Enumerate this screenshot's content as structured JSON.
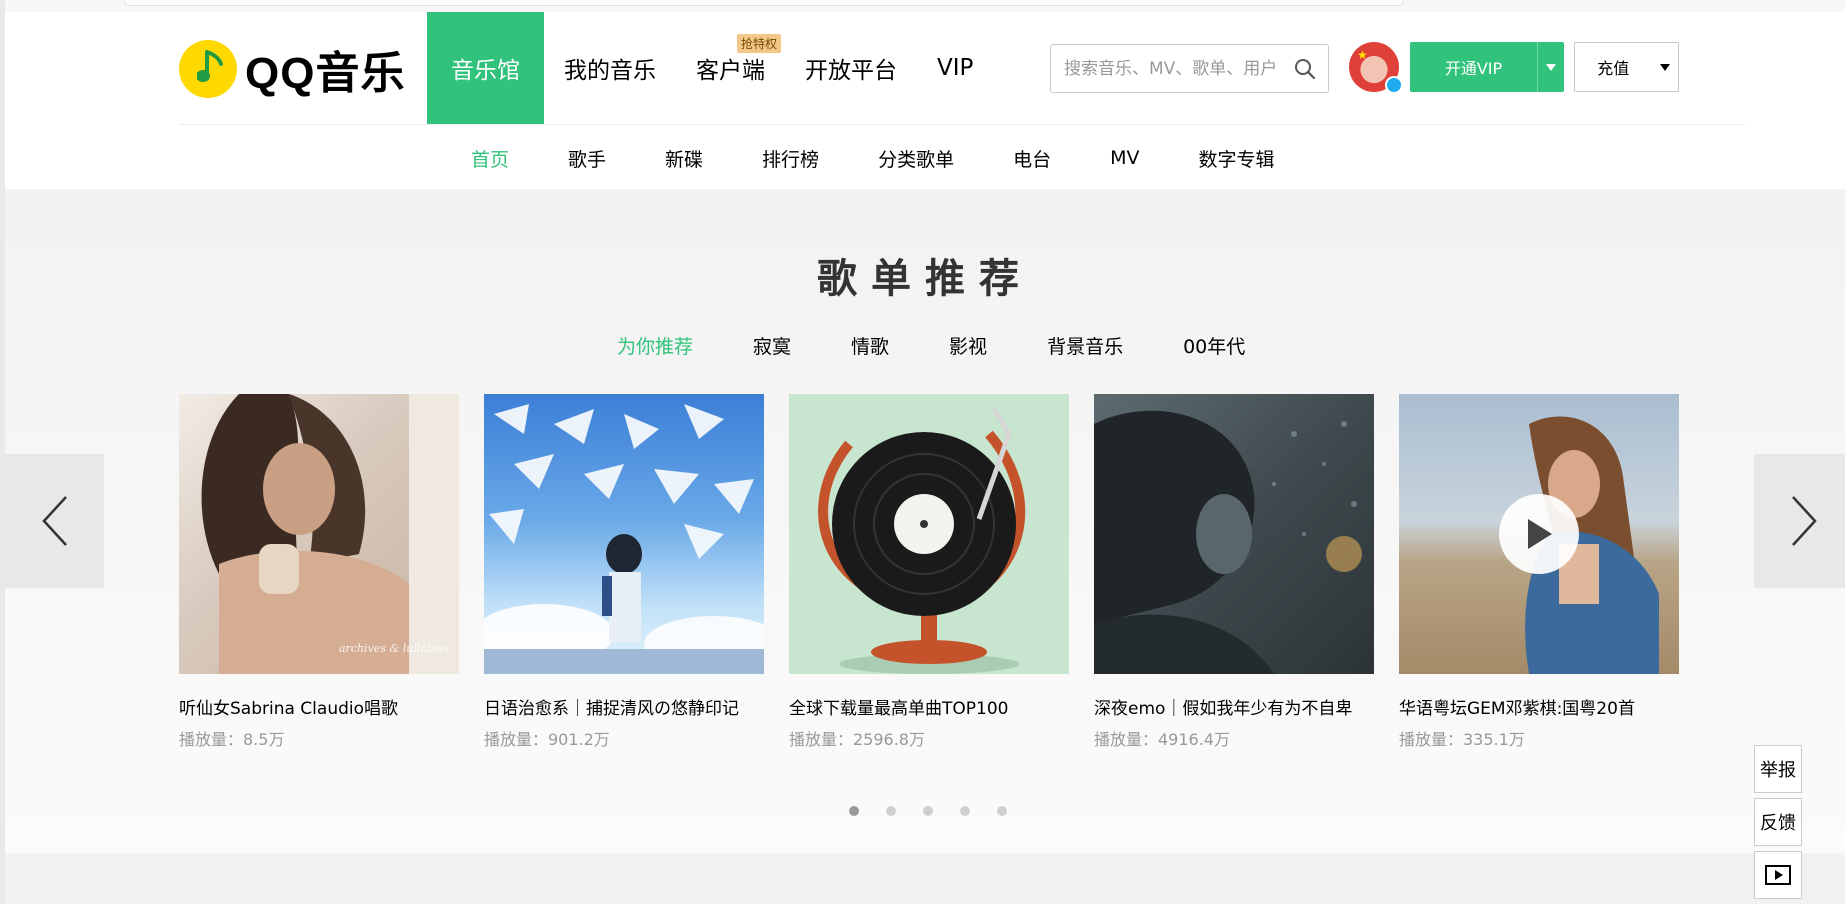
{
  "header": {
    "logo_text": "QQ音乐",
    "nav": [
      {
        "label": "音乐馆",
        "active": true
      },
      {
        "label": "我的音乐"
      },
      {
        "label": "客户端",
        "badge": "抢特权"
      },
      {
        "label": "开放平台"
      },
      {
        "label": "VIP"
      }
    ],
    "search_placeholder": "搜索音乐、MV、歌单、用户",
    "vip_button": "开通VIP",
    "recharge_button": "充值"
  },
  "subnav": [
    {
      "label": "首页",
      "active": true
    },
    {
      "label": "歌手"
    },
    {
      "label": "新碟"
    },
    {
      "label": "排行榜"
    },
    {
      "label": "分类歌单"
    },
    {
      "label": "电台"
    },
    {
      "label": "MV"
    },
    {
      "label": "数字专辑"
    }
  ],
  "playlist_section": {
    "title": "歌单推荐",
    "tabs": [
      {
        "label": "为你推荐",
        "active": true
      },
      {
        "label": "寂寞"
      },
      {
        "label": "情歌"
      },
      {
        "label": "影视"
      },
      {
        "label": "背景音乐"
      },
      {
        "label": "00年代"
      }
    ],
    "cards": [
      {
        "title": "听仙女Sabrina Claudio唱歌",
        "plays": "播放量：8.5万",
        "cover_text": "archives & lullabies"
      },
      {
        "title": "日语治愈系｜捕捉清风の悠静印记",
        "plays": "播放量：901.2万"
      },
      {
        "title": "全球下载量最高单曲TOP100",
        "plays": "播放量：2596.8万"
      },
      {
        "title": "深夜emo｜假如我年少有为不自卑",
        "plays": "播放量：4916.4万"
      },
      {
        "title": "华语粤坛GEM邓紫棋:国粤20首",
        "plays": "播放量：335.1万"
      }
    ],
    "pagination_pages": 5,
    "active_page": 1
  },
  "side_tools": {
    "report": "举报",
    "feedback": "反馈"
  },
  "colors": {
    "accent": "#31c27c",
    "logo_yellow": "#ffd800"
  }
}
